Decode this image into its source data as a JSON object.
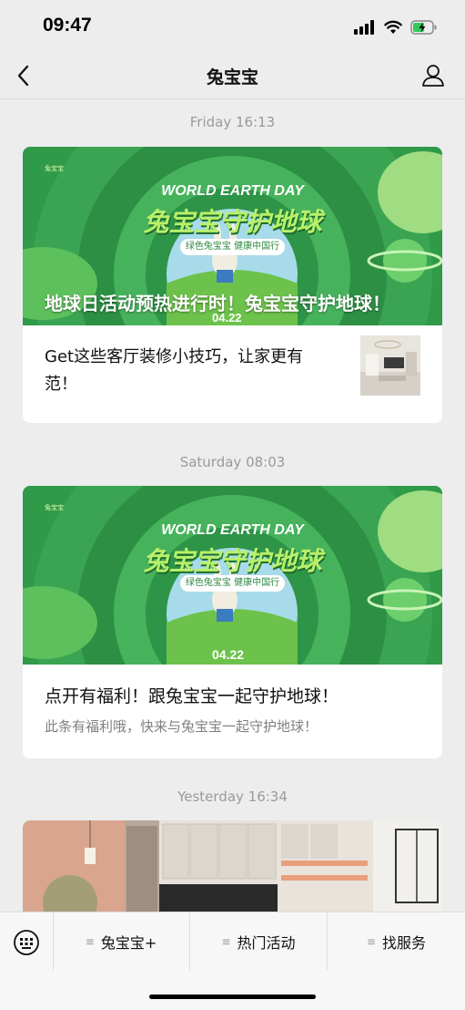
{
  "status_bar": {
    "time": "09:47"
  },
  "nav": {
    "title": "兔宝宝"
  },
  "feed": [
    {
      "timestamp": "Friday 16:13",
      "banner": {
        "tagline": "WORLD EARTH DAY",
        "slogan": "兔宝宝守护地球",
        "pill": "绿色兔宝宝  健康中国行",
        "date": "04.22",
        "headline": "地球日活动预热进行时！兔宝宝守护地球！"
      },
      "sub_article": {
        "title": "Get这些客厅装修小技巧，让家更有范！"
      }
    },
    {
      "timestamp": "Saturday 08:03",
      "banner": {
        "tagline": "WORLD EARTH DAY",
        "slogan": "兔宝宝守护地球",
        "pill": "绿色兔宝宝  健康中国行",
        "date": "04.22"
      },
      "title": "点开有福利！跟兔宝宝一起守护地球！",
      "description": "此条有福利哦，快来与兔宝宝一起守护地球！"
    },
    {
      "timestamp": "Yesterday 16:34"
    }
  ],
  "menu": {
    "items": [
      {
        "label": "兔宝宝+"
      },
      {
        "label": "热门活动"
      },
      {
        "label": "找服务"
      }
    ]
  },
  "colors": {
    "background": "#ededed",
    "banner_green": "#3fae55",
    "accent_green": "#91d94b"
  }
}
